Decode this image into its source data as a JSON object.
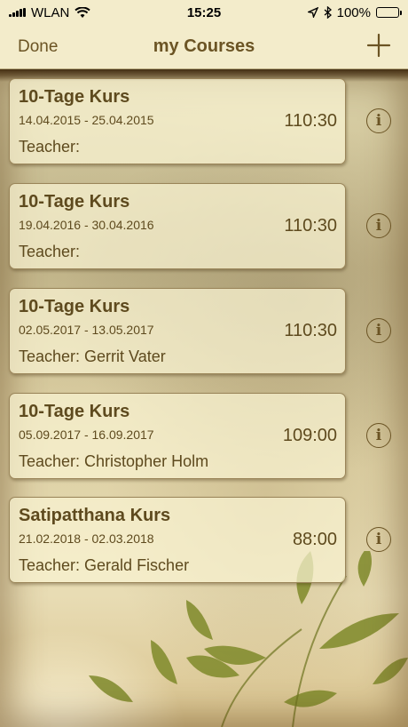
{
  "status_bar": {
    "carrier": "WLAN",
    "time": "15:25",
    "battery": "100%",
    "icons": [
      "signal-icon",
      "wifi-icon",
      "location-arrow-icon",
      "bluetooth-icon",
      "battery-icon"
    ]
  },
  "nav": {
    "done_label": "Done",
    "title": "my Courses",
    "add_icon": "plus-icon"
  },
  "courses": [
    {
      "title": "10-Tage Kurs",
      "dates": "14.04.2015 - 25.04.2015",
      "teacher": "Teacher:",
      "time": "110:30",
      "info_icon": "info-icon"
    },
    {
      "title": "10-Tage Kurs",
      "dates": "19.04.2016 - 30.04.2016",
      "teacher": "Teacher:",
      "time": "110:30",
      "info_icon": "info-icon"
    },
    {
      "title": "10-Tage Kurs",
      "dates": "02.05.2017 - 13.05.2017",
      "teacher": "Teacher: Gerrit Vater",
      "time": "110:30",
      "info_icon": "info-icon"
    },
    {
      "title": "10-Tage Kurs",
      "dates": "05.09.2017 - 16.09.2017",
      "teacher": "Teacher: Christopher Holm",
      "time": "109:00",
      "info_icon": "info-icon"
    },
    {
      "title": "Satipatthana Kurs",
      "dates": "21.02.2018 - 02.03.2018",
      "teacher": "Teacher: Gerald Fischer",
      "time": "88:00",
      "info_icon": "info-icon"
    }
  ],
  "colors": {
    "accent": "#6b5424",
    "text": "#5e4a1e",
    "nav_background": "#f3eccb"
  }
}
